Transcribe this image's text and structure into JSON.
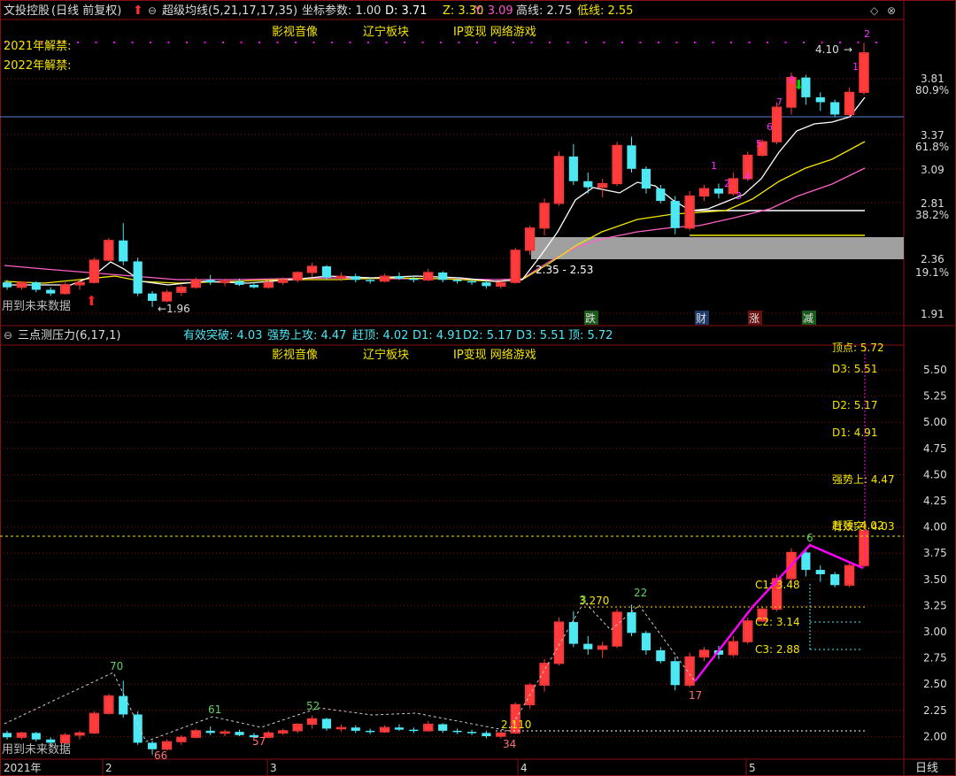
{
  "colors": {
    "up": "#ff3b3b",
    "down": "#4de8f4",
    "yellow": "#f5e500",
    "magenta": "#ff00ff",
    "white": "#ffffff",
    "green": "#00c800",
    "grid": "#8a1010",
    "gray_band": "#a0a0a0"
  },
  "header": {
    "stock_name": "文投控股",
    "mode": "(日线 前复权)",
    "indicator": "超级均线(5,21,17,17,35)",
    "coord_label": "坐标参数: 1.00",
    "d_label": "D: 3.71",
    "z_label": "Z: 3.30",
    "y_label": "Y: 3.09",
    "high_label": "高线: 2.75",
    "low_label": "低线: 2.55"
  },
  "tags": [
    "影视音像",
    "辽宁板块",
    "IP变现 网络游戏"
  ],
  "lifts": [
    "2021年解禁:",
    "2022年解禁:"
  ],
  "top_notes": {
    "future": "用到未来数据",
    "low_mark": "←1.96",
    "range_mark": "2.35 - 2.53",
    "high_mark": "4.10",
    "high_arrow": "→",
    "sig_fall": "跌",
    "sig_fin": "财",
    "sig_rise": "涨",
    "sig_cut": "减",
    "lower_arrow_up": "⬆",
    "lower_arrow_down": "⬇"
  },
  "top_axis": {
    "prices": [
      "3.81",
      "3.37",
      "3.09",
      "2.81",
      "2.36",
      "1.91"
    ],
    "percents": [
      "80.9%",
      "61.8%",
      "38.2%",
      "19.1%"
    ]
  },
  "bottom_header": {
    "title": "三点测压力(6,17,1)",
    "breakout": "有效突破: 4.03",
    "strong": "强势上攻: 4.47",
    "catch_top": "赶顶: 4.02",
    "d1": "D1: 4.91",
    "d2": "D2: 5.17",
    "d3": "D3: 5.51",
    "top": "顶: 5.72"
  },
  "bottom_labels": {
    "top_cut": "顶点: 5.72",
    "d3": "D3: 5.51",
    "d2": "D2: 5.17",
    "d1": "D1: 4.91",
    "strong": "强势上: 4.47",
    "overlap_a": "有效突: 4.03",
    "overlap_b": "赶顶: 4.02",
    "c1": "C1: 3.48",
    "c2": "C2: 3.14",
    "c3": "C3: 2.88",
    "p1": "3.270",
    "p2": "2.110"
  },
  "bottom_axis": [
    "5.50",
    "5.25",
    "5.00",
    "4.75",
    "4.50",
    "4.25",
    "4.00",
    "3.75",
    "3.50",
    "3.25",
    "3.00",
    "2.75",
    "2.50",
    "2.25",
    "2.00"
  ],
  "pivots": {
    "a": "70",
    "b": "66",
    "c": "61",
    "d": "57",
    "e": "52",
    "f": "34",
    "g": "3",
    "h": "22",
    "i": "17",
    "j": "6"
  },
  "counts": [
    "1",
    "2",
    "3",
    "4",
    "5",
    "6",
    "7",
    "8",
    "1",
    "2"
  ],
  "footer": {
    "year": "2021年",
    "months": [
      "2",
      "3",
      "4",
      "5"
    ],
    "future": "用到未来数据",
    "period": "日线"
  },
  "chart_data": {
    "type": "candlestick",
    "title": "文投控股 (日线 前复权)",
    "ylim_top": [
      1.91,
      3.81
    ],
    "ylim_bottom": [
      2.0,
      5.5
    ],
    "candles": [
      [
        2.16,
        2.18,
        2.1,
        2.12
      ],
      [
        2.12,
        2.17,
        2.1,
        2.16
      ],
      [
        2.16,
        2.17,
        2.08,
        2.1
      ],
      [
        2.1,
        2.12,
        2.05,
        2.07
      ],
      [
        2.07,
        2.16,
        2.06,
        2.14
      ],
      [
        2.14,
        2.18,
        2.1,
        2.16
      ],
      [
        2.16,
        2.36,
        2.15,
        2.34
      ],
      [
        2.34,
        2.52,
        2.33,
        2.5
      ],
      [
        2.5,
        2.64,
        2.3,
        2.33
      ],
      [
        2.33,
        2.36,
        2.05,
        2.07
      ],
      [
        2.07,
        2.09,
        1.96,
        2.01
      ],
      [
        2.01,
        2.1,
        2.0,
        2.08
      ],
      [
        2.08,
        2.14,
        2.05,
        2.12
      ],
      [
        2.12,
        2.2,
        2.11,
        2.18
      ],
      [
        2.18,
        2.22,
        2.14,
        2.16
      ],
      [
        2.16,
        2.19,
        2.13,
        2.17
      ],
      [
        2.17,
        2.19,
        2.13,
        2.14
      ],
      [
        2.14,
        2.16,
        2.11,
        2.12
      ],
      [
        2.12,
        2.18,
        2.11,
        2.16
      ],
      [
        2.16,
        2.2,
        2.14,
        2.18
      ],
      [
        2.18,
        2.25,
        2.16,
        2.24
      ],
      [
        2.24,
        2.32,
        2.2,
        2.29
      ],
      [
        2.29,
        2.3,
        2.18,
        2.2
      ],
      [
        2.2,
        2.24,
        2.17,
        2.21
      ],
      [
        2.21,
        2.23,
        2.16,
        2.18
      ],
      [
        2.18,
        2.2,
        2.15,
        2.17
      ],
      [
        2.17,
        2.23,
        2.16,
        2.21
      ],
      [
        2.21,
        2.24,
        2.18,
        2.19
      ],
      [
        2.19,
        2.21,
        2.16,
        2.18
      ],
      [
        2.18,
        2.27,
        2.17,
        2.24
      ],
      [
        2.24,
        2.25,
        2.16,
        2.18
      ],
      [
        2.18,
        2.2,
        2.15,
        2.17
      ],
      [
        2.17,
        2.19,
        2.14,
        2.16
      ],
      [
        2.16,
        2.18,
        2.11,
        2.13
      ],
      [
        2.13,
        2.17,
        2.11,
        2.16
      ],
      [
        2.16,
        2.44,
        2.15,
        2.42
      ],
      [
        2.42,
        2.62,
        2.38,
        2.6
      ],
      [
        2.6,
        2.84,
        2.54,
        2.8
      ],
      [
        2.8,
        3.22,
        2.78,
        3.18
      ],
      [
        3.18,
        3.28,
        2.95,
        2.98
      ],
      [
        2.98,
        3.05,
        2.88,
        2.93
      ],
      [
        2.93,
        3.0,
        2.85,
        2.96
      ],
      [
        2.96,
        3.3,
        2.94,
        3.27
      ],
      [
        3.27,
        3.34,
        3.05,
        3.08
      ],
      [
        3.08,
        3.1,
        2.88,
        2.92
      ],
      [
        2.92,
        2.95,
        2.8,
        2.82
      ],
      [
        2.82,
        2.86,
        2.55,
        2.6
      ],
      [
        2.6,
        2.9,
        2.58,
        2.86
      ],
      [
        2.86,
        2.95,
        2.82,
        2.92
      ],
      [
        2.92,
        2.96,
        2.84,
        2.88
      ],
      [
        2.88,
        3.05,
        2.86,
        3.0
      ],
      [
        3.0,
        3.22,
        2.98,
        3.19
      ],
      [
        3.19,
        3.32,
        3.18,
        3.3
      ],
      [
        3.3,
        3.62,
        3.28,
        3.58
      ],
      [
        3.58,
        3.86,
        3.52,
        3.82
      ],
      [
        3.82,
        3.84,
        3.6,
        3.66
      ],
      [
        3.66,
        3.7,
        3.55,
        3.62
      ],
      [
        3.62,
        3.64,
        3.5,
        3.52
      ],
      [
        3.52,
        3.74,
        3.5,
        3.7
      ],
      [
        3.7,
        4.1,
        3.68,
        4.02
      ]
    ]
  }
}
